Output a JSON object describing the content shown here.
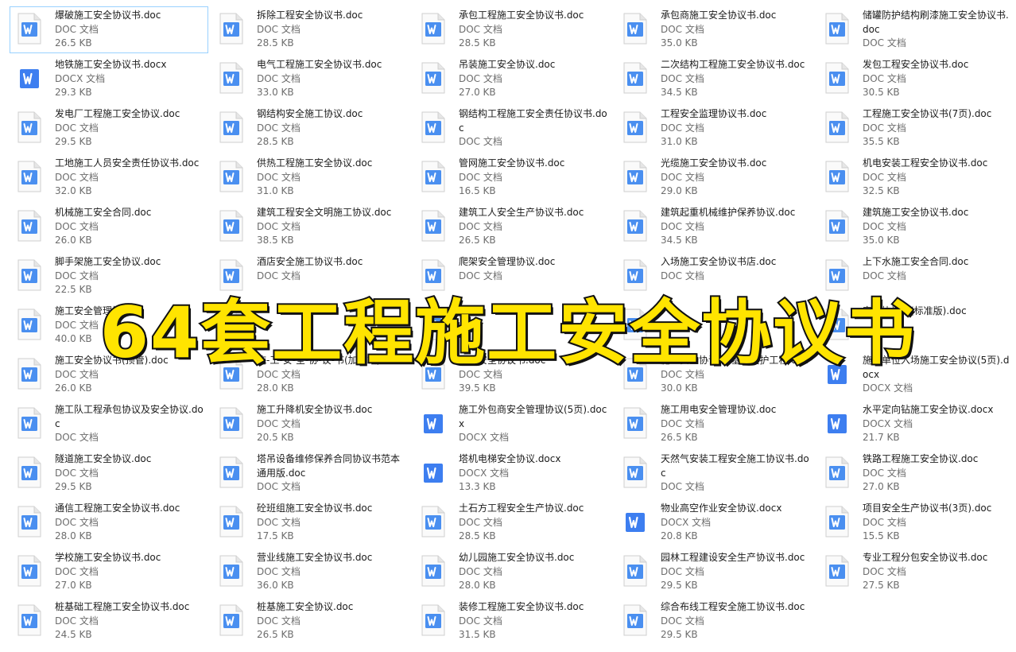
{
  "banner": "64套工程施工安全协议书",
  "colors": {
    "doc_icon": "#4a8ff0",
    "docx_icon": "#3d7ef0",
    "banner_fill": "#ffe400",
    "selection_border": "#99d1ff"
  },
  "files": [
    {
      "name": "爆破施工安全协议书.doc",
      "type": "DOC 文档",
      "size": "26.5 KB",
      "icon": "word-doc-icon",
      "selected": true
    },
    {
      "name": "拆除工程安全协议书.doc",
      "type": "DOC 文档",
      "size": "28.5 KB",
      "icon": "word-doc-icon"
    },
    {
      "name": "承包工程施工安全协议书.doc",
      "type": "DOC 文档",
      "size": "28.5 KB",
      "icon": "word-doc-icon"
    },
    {
      "name": "承包商施工安全协议书.doc",
      "type": "DOC 文档",
      "size": "35.0 KB",
      "icon": "word-doc-icon"
    },
    {
      "name": "储罐防护结构刷漆施工安全协议书.doc",
      "type": "DOC 文档",
      "size": "",
      "icon": "word-doc-icon"
    },
    {
      "name": "地铁施工安全协议书.docx",
      "type": "DOCX 文档",
      "size": "29.3 KB",
      "icon": "word-docx-icon"
    },
    {
      "name": "电气工程施工安全协议书.doc",
      "type": "DOC 文档",
      "size": "33.0 KB",
      "icon": "word-doc-icon"
    },
    {
      "name": "吊装施工安全协议.doc",
      "type": "DOC 文档",
      "size": "27.0 KB",
      "icon": "word-doc-icon"
    },
    {
      "name": "二次结构工程施工安全协议书.doc",
      "type": "DOC 文档",
      "size": "34.5 KB",
      "icon": "word-doc-icon"
    },
    {
      "name": "发包工程安全协议书.doc",
      "type": "DOC 文档",
      "size": "30.5 KB",
      "icon": "word-doc-icon"
    },
    {
      "name": "发电厂工程施工安全协议.doc",
      "type": "DOC 文档",
      "size": "29.5 KB",
      "icon": "word-doc-icon"
    },
    {
      "name": "钢结构安全施工协议.doc",
      "type": "DOC 文档",
      "size": "28.5 KB",
      "icon": "word-doc-icon"
    },
    {
      "name": "钢结构工程施工安全责任协议书.doc",
      "type": "DOC 文档",
      "size": "",
      "icon": "word-doc-icon"
    },
    {
      "name": "工程安全监理协议书.doc",
      "type": "DOC 文档",
      "size": "31.0 KB",
      "icon": "word-doc-icon"
    },
    {
      "name": "工程施工安全协议书(7页).doc",
      "type": "DOC 文档",
      "size": "35.5 KB",
      "icon": "word-doc-icon"
    },
    {
      "name": "工地施工人员安全责任协议书.doc",
      "type": "DOC 文档",
      "size": "32.0 KB",
      "icon": "word-doc-icon"
    },
    {
      "name": "供热工程施工安全协议.doc",
      "type": "DOC 文档",
      "size": "31.0 KB",
      "icon": "word-doc-icon"
    },
    {
      "name": "管网施工安全协议书.doc",
      "type": "DOC 文档",
      "size": "16.5 KB",
      "icon": "word-doc-icon"
    },
    {
      "name": "光缆施工安全协议书.doc",
      "type": "DOC 文档",
      "size": "29.0 KB",
      "icon": "word-doc-icon"
    },
    {
      "name": "机电安装工程安全协议书.doc",
      "type": "DOC 文档",
      "size": "32.5 KB",
      "icon": "word-doc-icon"
    },
    {
      "name": "机械施工安全合同.doc",
      "type": "DOC 文档",
      "size": "26.0 KB",
      "icon": "word-doc-icon"
    },
    {
      "name": "建筑工程安全文明施工协议.doc",
      "type": "DOC 文档",
      "size": "38.5 KB",
      "icon": "word-doc-icon"
    },
    {
      "name": "建筑工人安全生产协议书.doc",
      "type": "DOC 文档",
      "size": "26.5 KB",
      "icon": "word-doc-icon"
    },
    {
      "name": "建筑起重机械维护保养协议.doc",
      "type": "DOC 文档",
      "size": "34.5 KB",
      "icon": "word-doc-icon"
    },
    {
      "name": "建筑施工安全协议书.doc",
      "type": "DOC 文档",
      "size": "35.0 KB",
      "icon": "word-doc-icon"
    },
    {
      "name": "脚手架施工安全协议.doc",
      "type": "DOC 文档",
      "size": "22.5 KB",
      "icon": "word-doc-icon"
    },
    {
      "name": "酒店安全施工协议书.doc",
      "type": "DOC 文档",
      "size": "",
      "icon": "word-doc-icon"
    },
    {
      "name": "爬架安全管理协议.doc",
      "type": "DOC 文档",
      "size": "",
      "icon": "word-doc-icon"
    },
    {
      "name": "入场施工安全协议书店.doc",
      "type": "DOC 文档",
      "size": "",
      "icon": "word-doc-icon"
    },
    {
      "name": "上下水施工安全合同.doc",
      "type": "DOC 文档",
      "size": "",
      "icon": "word-doc-icon"
    },
    {
      "name": "施工安全管理协议",
      "type": "DOC 文档",
      "size": "40.0 KB",
      "icon": "word-doc-icon"
    },
    {
      "name": "",
      "type": "",
      "size": "",
      "icon": "word-doc-icon"
    },
    {
      "name": "",
      "type": "",
      "size": "",
      "icon": "word-doc-icon"
    },
    {
      "name": "",
      "type": "",
      "size": "",
      "icon": "word-doc-icon"
    },
    {
      "name": "安全协议书(标准版).doc",
      "type": "",
      "size": "",
      "icon": "word-doc-icon"
    },
    {
      "name": "施工安全协议书(顶管).doc",
      "type": "DOC 文档",
      "size": "26.0 KB",
      "icon": "word-doc-icon"
    },
    {
      "name": "施-工-安-全-协-议-书(加气站).doc",
      "type": "DOC 文档",
      "size": "28.0 KB",
      "icon": "word-doc-icon"
    },
    {
      "name": "施工安全协议书.doc",
      "type": "DOC 文档",
      "size": "39.5 KB",
      "icon": "word-doc-icon"
    },
    {
      "name": "施工安全协议书-基坑支护工程.doc",
      "type": "DOC 文档",
      "size": "30.0 KB",
      "icon": "word-doc-icon"
    },
    {
      "name": "施工单位入场施工安全协议(5页).docx",
      "type": "DOCX 文档",
      "size": "",
      "icon": "word-docx-icon"
    },
    {
      "name": "施工队工程承包协议及安全协议.doc",
      "type": "DOC 文档",
      "size": "",
      "icon": "word-doc-icon"
    },
    {
      "name": "施工升降机安全协议书.doc",
      "type": "DOC 文档",
      "size": "20.5 KB",
      "icon": "word-doc-icon"
    },
    {
      "name": "施工外包商安全管理协议(5页).docx",
      "type": "DOCX 文档",
      "size": "",
      "icon": "word-docx-icon"
    },
    {
      "name": "施工用电安全管理协议.doc",
      "type": "DOC 文档",
      "size": "26.5 KB",
      "icon": "word-doc-icon"
    },
    {
      "name": "水平定向钻施工安全协议.docx",
      "type": "DOCX 文档",
      "size": "21.7 KB",
      "icon": "word-docx-icon"
    },
    {
      "name": "隧道施工安全协议.doc",
      "type": "DOC 文档",
      "size": "29.5 KB",
      "icon": "word-doc-icon"
    },
    {
      "name": "塔吊设备维修保养合同协议书范本通用版.doc",
      "type": "DOC 文档",
      "size": "",
      "icon": "word-doc-icon"
    },
    {
      "name": "塔机电梯安全协议.docx",
      "type": "DOCX 文档",
      "size": "13.3 KB",
      "icon": "word-docx-icon"
    },
    {
      "name": "天然气安装工程安全施工协议书.doc",
      "type": "DOC 文档",
      "size": "",
      "icon": "word-doc-icon"
    },
    {
      "name": "铁路工程施工安全协议.doc",
      "type": "DOC 文档",
      "size": "27.0 KB",
      "icon": "word-doc-icon"
    },
    {
      "name": "通信工程施工安全协议书.doc",
      "type": "DOC 文档",
      "size": "28.0 KB",
      "icon": "word-doc-icon"
    },
    {
      "name": "砼班组施工安全协议书.doc",
      "type": "DOC 文档",
      "size": "17.5 KB",
      "icon": "word-doc-icon"
    },
    {
      "name": "土石方工程安全生产协议.doc",
      "type": "DOC 文档",
      "size": "28.5 KB",
      "icon": "word-doc-icon"
    },
    {
      "name": "物业高空作业安全协议.docx",
      "type": "DOCX 文档",
      "size": "20.8 KB",
      "icon": "word-docx-icon"
    },
    {
      "name": "项目安全生产协议书(3页).doc",
      "type": "DOC 文档",
      "size": "15.5 KB",
      "icon": "word-doc-icon"
    },
    {
      "name": "学校施工安全协议书.doc",
      "type": "DOC 文档",
      "size": "27.0 KB",
      "icon": "word-doc-icon"
    },
    {
      "name": "营业线施工安全协议书.doc",
      "type": "DOC 文档",
      "size": "36.0 KB",
      "icon": "word-doc-icon"
    },
    {
      "name": "幼儿园施工安全协议书.doc",
      "type": "DOC 文档",
      "size": "28.0 KB",
      "icon": "word-doc-icon"
    },
    {
      "name": "园林工程建设安全生产协议书.doc",
      "type": "DOC 文档",
      "size": "29.5 KB",
      "icon": "word-doc-icon"
    },
    {
      "name": "专业工程分包安全协议书.doc",
      "type": "DOC 文档",
      "size": "27.5 KB",
      "icon": "word-doc-icon"
    },
    {
      "name": "桩基础工程施工安全协议书.doc",
      "type": "DOC 文档",
      "size": "24.5 KB",
      "icon": "word-doc-icon"
    },
    {
      "name": "桩基施工安全协议.doc",
      "type": "DOC 文档",
      "size": "26.5 KB",
      "icon": "word-doc-icon"
    },
    {
      "name": "装修工程施工安全协议书.doc",
      "type": "DOC 文档",
      "size": "31.5 KB",
      "icon": "word-doc-icon"
    },
    {
      "name": "综合布线工程安全施工协议书.doc",
      "type": "DOC 文档",
      "size": "29.5 KB",
      "icon": "word-doc-icon"
    }
  ]
}
